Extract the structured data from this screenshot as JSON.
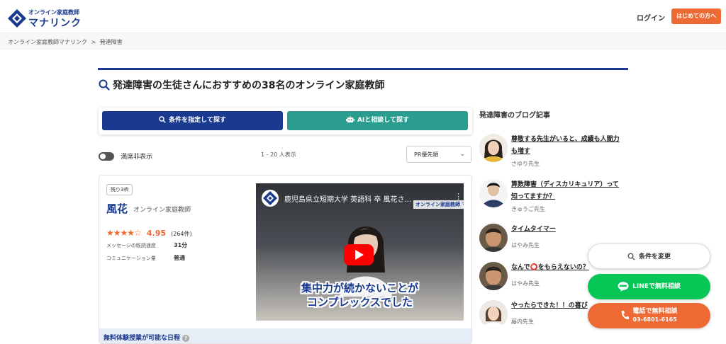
{
  "header": {
    "logo_sub": "オンライン家庭教師",
    "logo_main": "マナリンク",
    "login_label": "ログイン",
    "start_label": "はじめての方へ"
  },
  "breadcrumb": {
    "items": [
      "オンライン家庭教師マナリンク",
      "発達障害"
    ],
    "separator": ">"
  },
  "page": {
    "title": "発達障害の生徒さんにおすすめの38名のオンライン家庭教師"
  },
  "search": {
    "condition_label": "条件を指定して探す",
    "ai_label": "AIと相談して探す"
  },
  "filters": {
    "hide_full_label": "満席非表示",
    "count_text": "1 - 20 人表示",
    "sort_value": "PR優先順"
  },
  "tutor": {
    "remaining_badge": "残り3枠",
    "name": "風花",
    "type": "オンライン家庭教師",
    "stars": "★★★★☆",
    "rating": "4.95",
    "review_count": "(264件)",
    "stats": [
      {
        "label": "メッセージの既読速度",
        "value": "31分"
      },
      {
        "label": "コミュニケーション量",
        "value": "普通"
      }
    ],
    "video": {
      "title": "鹿児島県立短期大学 英語科 卒 風花さ...",
      "brand": "オンライン家庭教師 マナリンク",
      "caption_line1": "集中力が続かないことが",
      "caption_line2": "コンプレックスでした"
    },
    "availability_label": "無料体験授業が可能な日程",
    "availability_help": "?"
  },
  "blog": {
    "heading": "発達障害のブログ記事",
    "posts": [
      {
        "title": "尊敬する先生がいると、成績も人間力も増す",
        "author": "さゆり先生"
      },
      {
        "title": "算数障害（ディスカリキュリア）って知ってますか？",
        "author": "きゅうご先生"
      },
      {
        "title": "タイムタイマー",
        "author": "はやみ先生"
      },
      {
        "title": "なんで⭕️をもらえないの？",
        "author": "はやみ先生"
      },
      {
        "title": "やったらできた！！の喜び",
        "author": "藤内先生"
      }
    ]
  },
  "floating": {
    "condition_change_label": "条件を変更",
    "line_label": "LINEで無料相談",
    "tel_label": "電話で無料相談",
    "tel_number": "03-6801-6165"
  },
  "colors": {
    "brand_navy": "#1a3a8f",
    "accent_orange": "#ee6a34",
    "ai_teal": "#2a9d8f",
    "line_green": "#06c755"
  }
}
